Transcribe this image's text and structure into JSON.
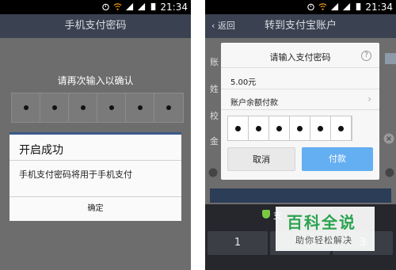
{
  "left": {
    "status_time": "21:34",
    "title": "手机支付密码",
    "prompt": "请再次输入以确认",
    "pin_dots": 6,
    "dialog": {
      "title": "开启成功",
      "message": "手机支付密码将用于手机支付",
      "confirm_label": "确定"
    }
  },
  "right": {
    "status_time": "21:34",
    "back_label": "返回",
    "title": "转到支付宝账户",
    "form_labels": [
      "账",
      "姓",
      "校",
      "金"
    ],
    "pay_dialog": {
      "title": "请输入支付密码",
      "help_icon": "?",
      "amount": "5.00元",
      "payment_method": "账户余额付款",
      "pin_dots": 6,
      "cancel_label": "取消",
      "pay_label": "付款"
    },
    "keyboard": {
      "banner_text": "支",
      "keys": [
        "1",
        "",
        "3"
      ]
    }
  },
  "watermark": {
    "brand": "百科全说",
    "tagline": "助你轻松解决"
  },
  "colors": {
    "accent_blue": "#64aef2",
    "titlebar": "#3a4150",
    "shield_green": "#7ac943",
    "watermark_green": "#2aa44f"
  }
}
